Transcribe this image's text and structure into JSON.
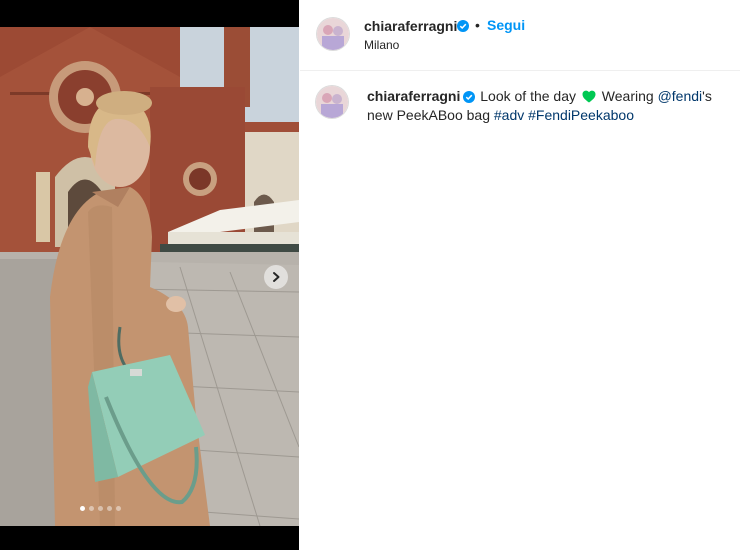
{
  "post": {
    "carousel": {
      "slide_count": 5,
      "active_index": 0
    }
  },
  "header": {
    "username": "chiaraferragni",
    "separator": "•",
    "follow_label": "Segui",
    "location": "Milano"
  },
  "caption": {
    "username": "chiaraferragni",
    "text1": "Look of the day",
    "text2": "Wearing",
    "mention": "@fendi",
    "text3": "'s new PeekABoo bag",
    "hashtag1": "#adv",
    "hashtag2": "#FendiPeekaboo"
  },
  "colors": {
    "accent": "#0095f6",
    "link": "#00376b",
    "verified": "#0095f6",
    "heart": "#00c853"
  },
  "icons": {
    "next": "chevron-right-icon",
    "verified": "verified-badge-icon",
    "heart": "green-heart-icon"
  }
}
